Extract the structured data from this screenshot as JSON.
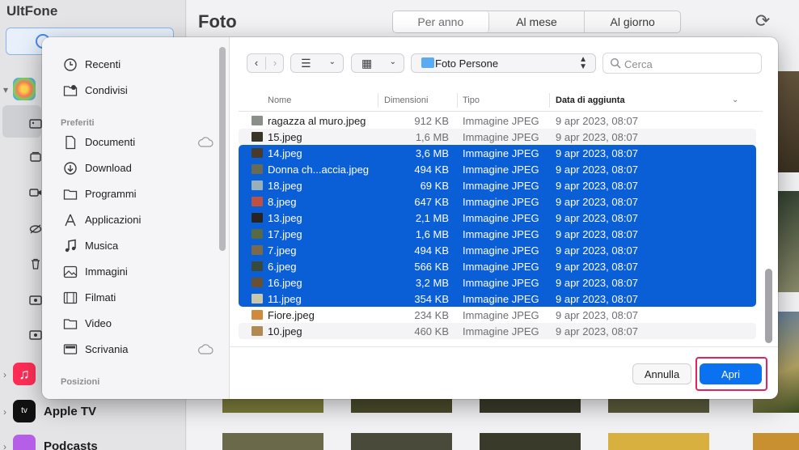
{
  "app": {
    "name": "UltFone",
    "main_title": "Foto",
    "segments": [
      "Per anno",
      "Al mese",
      "Al giorno"
    ],
    "active_segment": 0,
    "apps": [
      {
        "label": "",
        "color": "#ff2d55"
      },
      {
        "label": "Apple TV",
        "color": "#111111"
      },
      {
        "label": "Podcasts",
        "color": "#b55ee8"
      }
    ]
  },
  "dialog": {
    "sidebar": {
      "top_items": [
        {
          "label": "Recenti",
          "icon": "clock-icon"
        },
        {
          "label": "Condivisi",
          "icon": "shared-folder-icon"
        }
      ],
      "favorites_header": "Preferiti",
      "favorites": [
        {
          "label": "Documenti",
          "icon": "document-icon",
          "cloud": true
        },
        {
          "label": "Download",
          "icon": "download-icon",
          "cloud": false
        },
        {
          "label": "Programmi",
          "icon": "folder-icon",
          "cloud": false
        },
        {
          "label": "Applicazioni",
          "icon": "applications-icon",
          "cloud": false
        },
        {
          "label": "Musica",
          "icon": "music-note-icon",
          "cloud": false
        },
        {
          "label": "Immagini",
          "icon": "photo-icon",
          "cloud": false
        },
        {
          "label": "Filmati",
          "icon": "film-icon",
          "cloud": false
        },
        {
          "label": "Video",
          "icon": "folder-icon",
          "cloud": false
        },
        {
          "label": "Scrivania",
          "icon": "desktop-icon",
          "cloud": true
        }
      ],
      "locations_header": "Posizioni"
    },
    "toolbar": {
      "path": "Foto Persone",
      "search_placeholder": "Cerca"
    },
    "columns": {
      "name": "Nome",
      "size": "Dimensioni",
      "type": "Tipo",
      "date": "Data di aggiunta"
    },
    "files": [
      {
        "name": "ragazza al muro.jpeg",
        "size": "912 KB",
        "type": "Immagine JPEG",
        "date": "9 apr 2023, 08:07",
        "selected": false,
        "thumb": "#8a8f8a"
      },
      {
        "name": "15.jpeg",
        "size": "1,6 MB",
        "type": "Immagine JPEG",
        "date": "9 apr 2023, 08:07",
        "selected": false,
        "thumb": "#3a3424"
      },
      {
        "name": "14.jpeg",
        "size": "3,6 MB",
        "type": "Immagine JPEG",
        "date": "9 apr 2023, 08:07",
        "selected": true,
        "thumb": "#4a3a2a"
      },
      {
        "name": "Donna ch...accia.jpeg",
        "size": "494 KB",
        "type": "Immagine JPEG",
        "date": "9 apr 2023, 08:07",
        "selected": true,
        "thumb": "#6a6a50"
      },
      {
        "name": "18.jpeg",
        "size": "69 KB",
        "type": "Immagine JPEG",
        "date": "9 apr 2023, 08:07",
        "selected": true,
        "thumb": "#9ab0b8"
      },
      {
        "name": "8.jpeg",
        "size": "647 KB",
        "type": "Immagine JPEG",
        "date": "9 apr 2023, 08:07",
        "selected": true,
        "thumb": "#c05040"
      },
      {
        "name": "13.jpeg",
        "size": "2,1 MB",
        "type": "Immagine JPEG",
        "date": "9 apr 2023, 08:07",
        "selected": true,
        "thumb": "#2a2420"
      },
      {
        "name": "17.jpeg",
        "size": "1,6 MB",
        "type": "Immagine JPEG",
        "date": "9 apr 2023, 08:07",
        "selected": true,
        "thumb": "#5a6a40"
      },
      {
        "name": "7.jpeg",
        "size": "494 KB",
        "type": "Immagine JPEG",
        "date": "9 apr 2023, 08:07",
        "selected": true,
        "thumb": "#7a6a4a"
      },
      {
        "name": "6.jpeg",
        "size": "566 KB",
        "type": "Immagine JPEG",
        "date": "9 apr 2023, 08:07",
        "selected": true,
        "thumb": "#3a4a3a"
      },
      {
        "name": "16.jpeg",
        "size": "3,2 MB",
        "type": "Immagine JPEG",
        "date": "9 apr 2023, 08:07",
        "selected": true,
        "thumb": "#6a5030"
      },
      {
        "name": "11.jpeg",
        "size": "354 KB",
        "type": "Immagine JPEG",
        "date": "9 apr 2023, 08:07",
        "selected": true,
        "thumb": "#c8c8a8"
      },
      {
        "name": "Fiore.jpeg",
        "size": "234 KB",
        "type": "Immagine JPEG",
        "date": "9 apr 2023, 08:07",
        "selected": false,
        "thumb": "#d08a40"
      },
      {
        "name": "10.jpeg",
        "size": "460 KB",
        "type": "Immagine JPEG",
        "date": "9 apr 2023, 08:07",
        "selected": false,
        "thumb": "#b08a50"
      }
    ],
    "buttons": {
      "cancel": "Annulla",
      "open": "Apri"
    }
  },
  "colors": {
    "selection": "#0a5fd7",
    "accent": "#0a72f0",
    "highlight": "#e0245e"
  }
}
